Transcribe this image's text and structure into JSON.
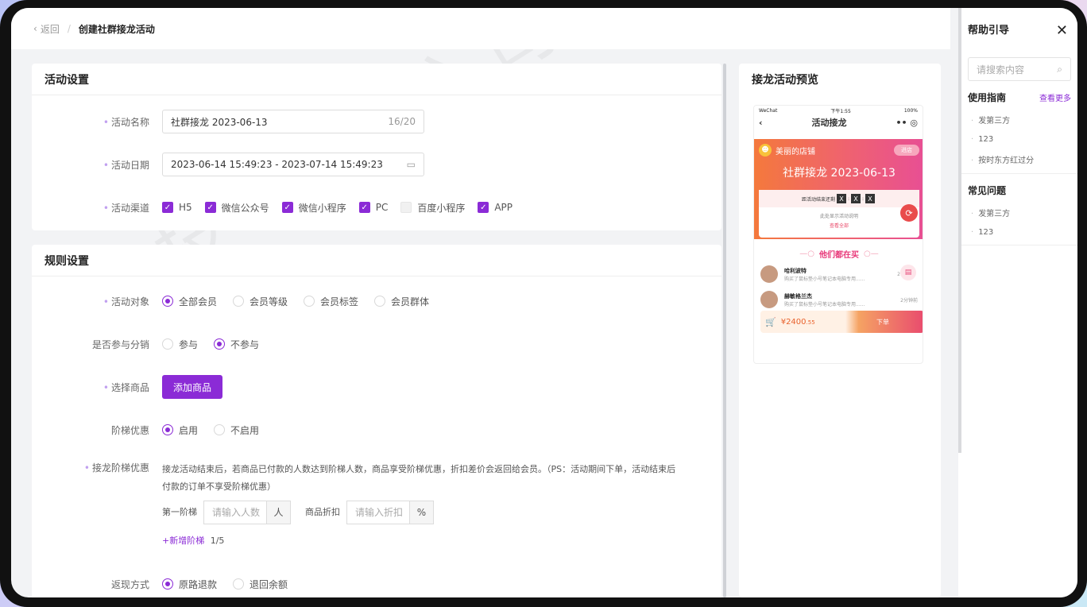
{
  "topbar": {
    "back_label": "返回",
    "separator": "/",
    "title": "创建社群接龙活动"
  },
  "activity": {
    "heading": "活动设置",
    "name_label": "活动名称",
    "name_value": "社群接龙  2023-06-13",
    "name_count": "16/20",
    "date_label": "活动日期",
    "date_value": "2023-06-14 15:49:23 - 2023-07-14 15:49:23",
    "channel_label": "活动渠道",
    "channels": [
      {
        "label": "H5",
        "checked": true
      },
      {
        "label": "微信公众号",
        "checked": true
      },
      {
        "label": "微信小程序",
        "checked": true
      },
      {
        "label": "PC",
        "checked": true
      },
      {
        "label": "百度小程序",
        "checked": false
      },
      {
        "label": "APP",
        "checked": true
      }
    ]
  },
  "rules": {
    "heading": "规则设置",
    "target_label": "活动对象",
    "targets": [
      {
        "label": "全部会员",
        "selected": true
      },
      {
        "label": "会员等级",
        "selected": false
      },
      {
        "label": "会员标签",
        "selected": false
      },
      {
        "label": "会员群体",
        "selected": false
      }
    ],
    "distribution_label": "是否参与分销",
    "distribution": [
      {
        "label": "参与",
        "selected": false
      },
      {
        "label": "不参与",
        "selected": true
      }
    ],
    "goods_label": "选择商品",
    "goods_button": "添加商品",
    "tier_label": "阶梯优惠",
    "tier": [
      {
        "label": "启用",
        "selected": true
      },
      {
        "label": "不启用",
        "selected": false
      }
    ],
    "jielong_label": "接龙阶梯优惠",
    "jielong_desc_1": "接龙活动结束后，若商品已付款的人数达到阶梯人数，商品享受阶梯优惠，折扣差价会返回给会员。（PS：活动期间下单，活动结束后",
    "jielong_desc_2": "付款的订单不享受阶梯优惠）",
    "step_label": "第一阶梯",
    "step_people_placeholder": "请输入人数",
    "step_people_unit": "人",
    "discount_label": "商品折扣",
    "discount_placeholder": "请输入折扣",
    "discount_unit": "%",
    "add_step": "+新增阶梯",
    "add_step_count": "1/5",
    "refund_label": "返现方式",
    "refund": [
      {
        "label": "原路退款",
        "selected": true
      },
      {
        "label": "退回余额",
        "selected": false
      }
    ]
  },
  "preview": {
    "heading": "接龙活动预览",
    "status_left": "WeChat",
    "status_time": "下午1:55",
    "status_right": "100%",
    "nav_title": "活动接龙",
    "shop_name": "美丽的店铺",
    "shop_pill": "进店",
    "banner_title": "社群接龙 2023-06-13",
    "countdown_label": "距活动结束还剩",
    "countdown_values": [
      "X",
      "X",
      "X"
    ],
    "desc_hint": "此处显示活动说明",
    "see_all": "查看全部",
    "buyers_heading": "他们都在买",
    "buyers": [
      {
        "name": "哈利波特",
        "desc": "购买了鼠标垫小号笔记本电脑专用......",
        "time": "2"
      },
      {
        "name": "赫敏格兰杰",
        "desc": "购买了鼠标垫小号笔记本电脑专用......",
        "time": "2分钟前"
      }
    ],
    "price": "¥2400",
    "price_decimal": ".55",
    "buy_label": "下单"
  },
  "help": {
    "title": "帮助引导",
    "search_placeholder": "请搜索内容",
    "guide_title": "使用指南",
    "guide_more": "查看更多",
    "guide_items": [
      "发第三方",
      "123",
      "按时东方红过分"
    ],
    "faq_title": "常见问题",
    "faq_items": [
      "发第三方",
      "123"
    ]
  },
  "colors": {
    "accent": "#8b2bd6",
    "banner_start": "#f4793c",
    "banner_end": "#e84f94"
  }
}
